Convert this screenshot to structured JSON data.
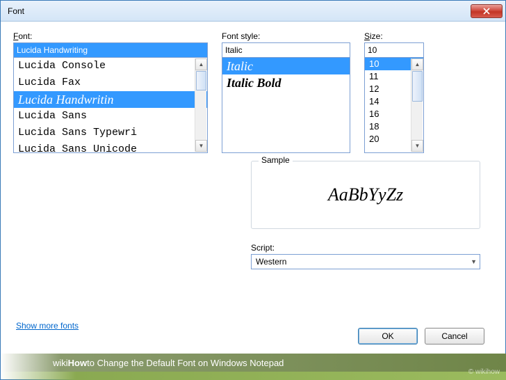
{
  "window": {
    "title": "Font"
  },
  "labels": {
    "font": "ont:",
    "font_style": "Font style:",
    "size": "ize:",
    "sample": "Sample",
    "script": "Script:",
    "show_more": "Show more fonts"
  },
  "inputs": {
    "font_value": "Lucida Handwriting",
    "style_value": "Italic",
    "size_value": "10"
  },
  "font_list": [
    {
      "label": "Lucida Console",
      "selected": false
    },
    {
      "label": "Lucida Fax",
      "selected": false
    },
    {
      "label": "Lucida Handwritin",
      "selected": true
    },
    {
      "label": "Lucida Sans",
      "selected": false
    },
    {
      "label": "Lucida Sans Typewri",
      "selected": false
    },
    {
      "label": "Lucida Sans Unicode",
      "selected": false
    }
  ],
  "style_list": [
    {
      "label": "Italic",
      "selected": true,
      "bold": false
    },
    {
      "label": "Italic Bold",
      "selected": false,
      "bold": true
    }
  ],
  "size_list": [
    {
      "label": "10",
      "selected": true
    },
    {
      "label": "11",
      "selected": false
    },
    {
      "label": "12",
      "selected": false
    },
    {
      "label": "14",
      "selected": false
    },
    {
      "label": "16",
      "selected": false
    },
    {
      "label": "18",
      "selected": false
    },
    {
      "label": "20",
      "selected": false
    }
  ],
  "sample_text": "AaBbYyZz",
  "script_value": "Western",
  "buttons": {
    "ok": "OK",
    "cancel": "Cancel"
  },
  "caption": {
    "wiki": "wiki",
    "how": "How",
    "text": " to Change the Default Font on Windows Notepad"
  },
  "watermark": "© wikihow"
}
